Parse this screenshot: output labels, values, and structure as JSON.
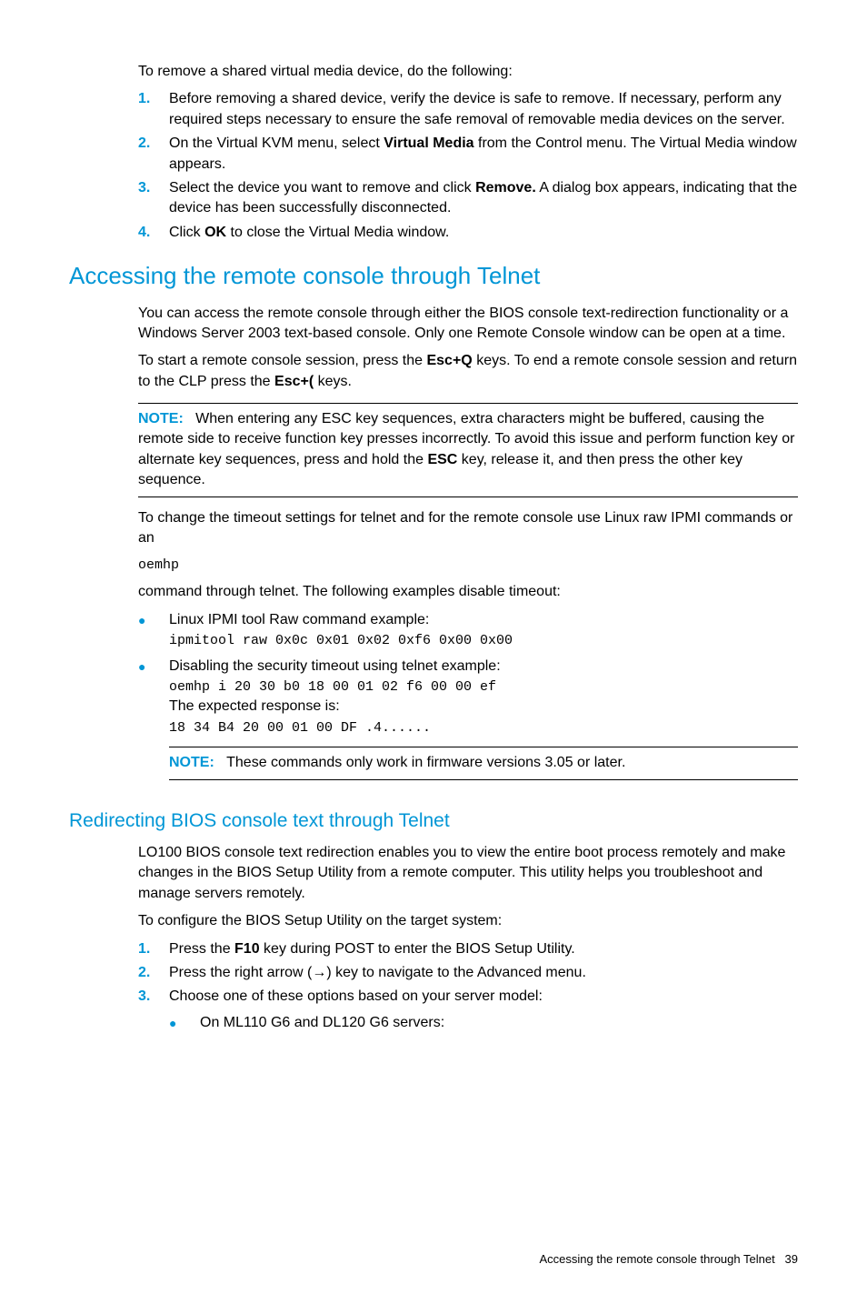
{
  "intro": {
    "lead": "To remove a shared virtual media device, do the following:",
    "steps": [
      {
        "num": "1.",
        "pre": "Before removing a shared device, verify the device is safe to remove. If necessary, perform any required steps necessary to ensure the safe removal of removable media devices on the server."
      },
      {
        "num": "2.",
        "pre": "On the Virtual KVM menu, select ",
        "bold": "Virtual Media",
        "post": " from the Control menu. The Virtual Media window appears."
      },
      {
        "num": "3.",
        "pre": "Select the device you want to remove and click ",
        "bold": "Remove.",
        "post": " A dialog box appears, indicating that the device has been successfully disconnected."
      },
      {
        "num": "4.",
        "pre": "Click ",
        "bold": "OK",
        "post": " to close the Virtual Media window."
      }
    ]
  },
  "section1": {
    "title": "Accessing the remote console through Telnet",
    "p1": "You can access the remote console through either the BIOS console text-redirection functionality or a Windows Server 2003 text-based console. Only one Remote Console window can be open at a time.",
    "p2_pre": "To start a remote console session, press the ",
    "p2_b1": "Esc+Q",
    "p2_mid": " keys. To end a remote console session and return to the CLP press the ",
    "p2_b2": "Esc+(",
    "p2_post": " keys.",
    "note1_label": "NOTE:",
    "note1_pre": "When entering any ESC key sequences, extra characters might be buffered, causing the remote side to receive function key presses incorrectly. To avoid this issue and perform function key or alternate key sequences, press and hold the ",
    "note1_bold": "ESC",
    "note1_post": " key, release it, and then press the other key sequence.",
    "p3": "To change the timeout settings for telnet and for the remote console use Linux raw IPMI commands or an",
    "code1": "oemhp",
    "p4": "command through telnet. The following examples disable timeout:",
    "bullets": [
      {
        "text": "Linux IPMI tool Raw command example:",
        "code": "ipmitool raw 0x0c 0x01 0x02 0xf6 0x00 0x00"
      },
      {
        "text": "Disabling the security timeout using telnet example:",
        "code": "oemhp i 20 30 b0 18 00 01 02 f6 00 00 ef",
        "resp_label": "The expected response is:",
        "resp_code": "18 34 B4 20 00 01 00 DF  .4......",
        "note_label": "NOTE:",
        "note_text": "These commands only work in firmware versions 3.05 or later."
      }
    ]
  },
  "section2": {
    "title": "Redirecting BIOS console text through Telnet",
    "p1": "LO100 BIOS console text redirection enables you to view the entire boot process remotely and make changes in the BIOS Setup Utility from a remote computer. This utility helps you troubleshoot and manage servers remotely.",
    "p2": "To configure the BIOS Setup Utility on the target system:",
    "steps": [
      {
        "num": "1.",
        "pre": "Press the ",
        "bold": "F10",
        "post": " key during POST to enter the BIOS Setup Utility."
      },
      {
        "num": "2.",
        "pre": "Press the right arrow (→) key to navigate to the Advanced menu."
      },
      {
        "num": "3.",
        "pre": "Choose one of these options based on your server model:"
      }
    ],
    "sub_bullet": "On ML110 G6 and DL120 G6 servers:"
  },
  "footer": {
    "text": "Accessing the remote console through Telnet",
    "page": "39"
  }
}
